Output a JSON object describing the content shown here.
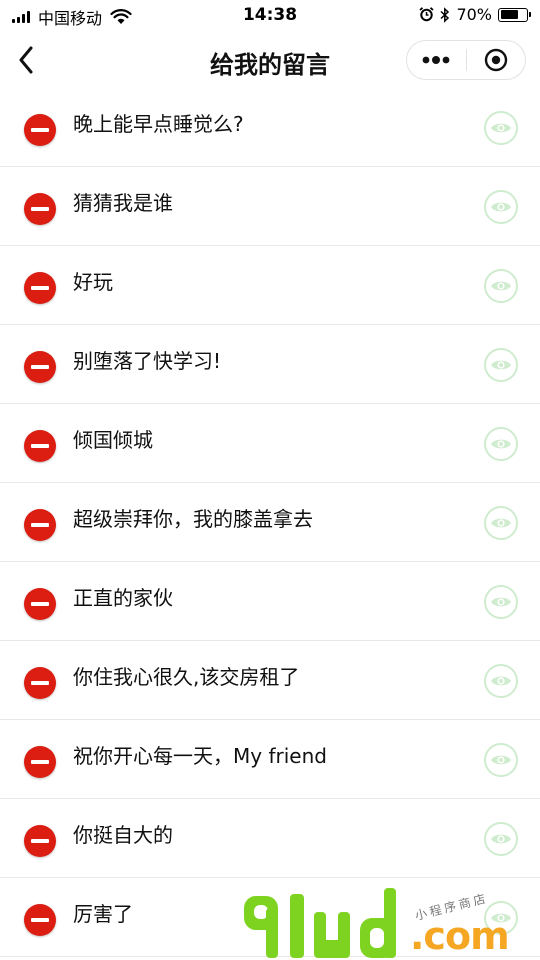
{
  "status_bar": {
    "carrier": "中国移动",
    "time": "14:38",
    "battery": "70%",
    "battery_level": 0.7,
    "icons": [
      "signal-icon",
      "wifi-icon",
      "alarm-icon",
      "bluetooth-icon",
      "battery-icon"
    ]
  },
  "nav": {
    "title": "给我的留言",
    "back_icon": "chevron-left-icon",
    "more_icon": "more-dots-icon",
    "close_icon": "target-close-icon"
  },
  "messages": [
    {
      "text": "晚上能早点睡觉么?"
    },
    {
      "text": "猜猜我是谁"
    },
    {
      "text": "好玩"
    },
    {
      "text": "别堕落了快学习!"
    },
    {
      "text": "倾国倾城"
    },
    {
      "text": "超级崇拜你，我的膝盖拿去"
    },
    {
      "text": "正直的家伙"
    },
    {
      "text": "你住我心很久,该交房租了"
    },
    {
      "text": "祝你开心每一天，My friend"
    },
    {
      "text": "你挺自大的"
    },
    {
      "text": "厉害了"
    }
  ],
  "colors": {
    "delete": "#db1d12",
    "view_icon": "#cfeccf",
    "watermark_green": "#7ed321",
    "watermark_orange": "#f5a623"
  },
  "watermark": {
    "logo": "91ud",
    "suffix": ".com",
    "tagline": "小程序商店"
  }
}
